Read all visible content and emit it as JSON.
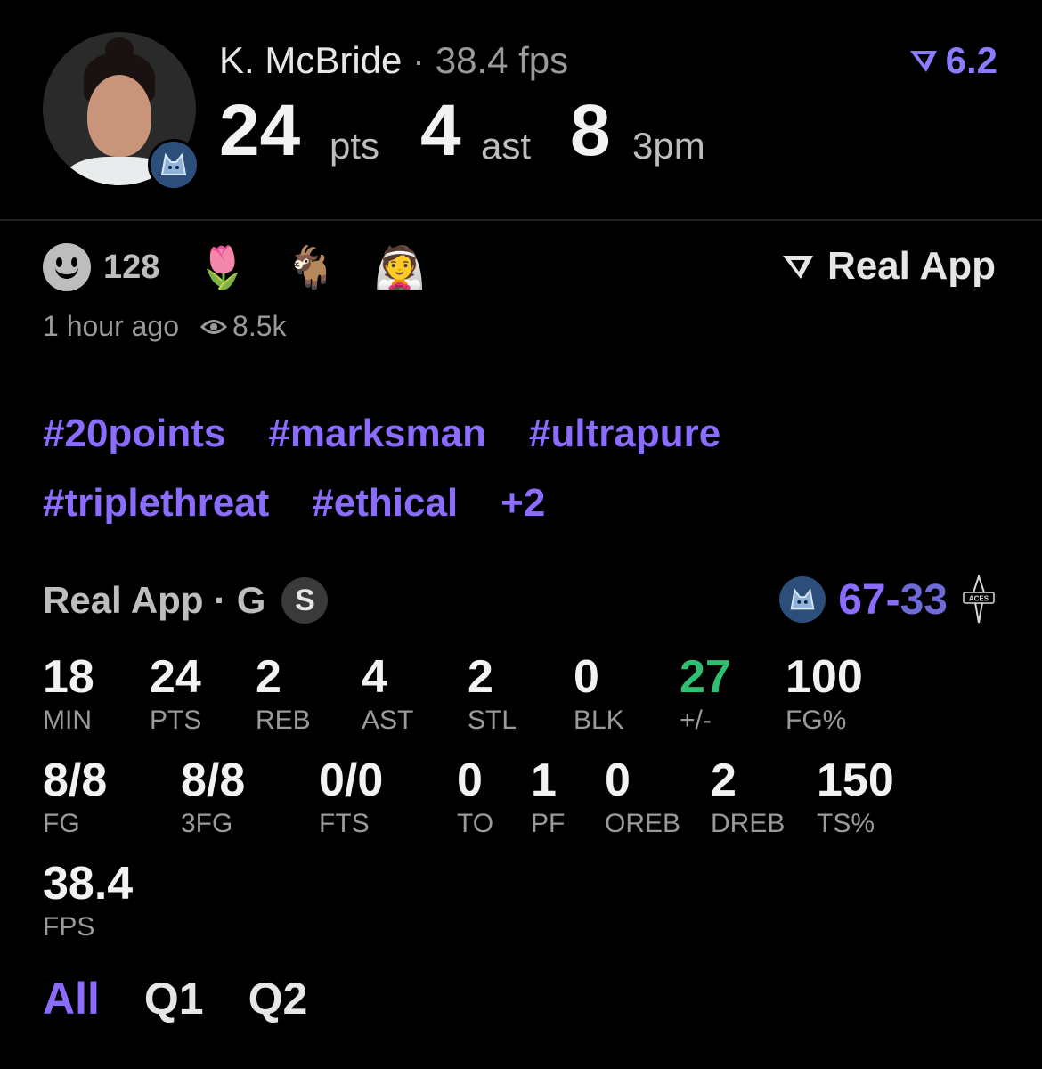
{
  "header": {
    "player_name": "K. McBride",
    "separator": " · ",
    "fps_text": "38.4 fps",
    "stats": [
      {
        "value": "24",
        "unit": "pts"
      },
      {
        "value": "4",
        "unit": "ast"
      },
      {
        "value": "8",
        "unit": "3pm"
      }
    ],
    "rating": "6.2"
  },
  "reactions": {
    "count": "128",
    "emojis": [
      {
        "name": "tulip",
        "glyph": "🌷"
      },
      {
        "name": "goat",
        "glyph": "🐐"
      },
      {
        "name": "bride",
        "glyph": "👰"
      }
    ]
  },
  "brand": "Real App",
  "meta": {
    "time_ago": "1 hour ago",
    "views": "8.5k"
  },
  "tags": {
    "row1": [
      "#20points",
      "#marksman",
      "#ultrapure"
    ],
    "row2": [
      "#triplethreat",
      "#ethical",
      "+2"
    ]
  },
  "game": {
    "label": "Real App · G",
    "badge": "S",
    "score_home": "67",
    "score_dash": "-",
    "score_away": "33"
  },
  "stats_rows": [
    [
      {
        "value": "18",
        "label": "MIN"
      },
      {
        "value": "24",
        "label": "PTS"
      },
      {
        "value": "2",
        "label": "REB"
      },
      {
        "value": "4",
        "label": "AST"
      },
      {
        "value": "2",
        "label": "STL"
      },
      {
        "value": "0",
        "label": "BLK"
      },
      {
        "value": "27",
        "label": "+/-",
        "color": "#2fbf71"
      },
      {
        "value": "100",
        "label": "FG%"
      }
    ],
    [
      {
        "value": "8/8",
        "label": "FG"
      },
      {
        "value": "8/8",
        "label": "3FG"
      },
      {
        "value": "0/0",
        "label": "FTS"
      },
      {
        "value": "0",
        "label": "TO"
      },
      {
        "value": "1",
        "label": "PF"
      },
      {
        "value": "0",
        "label": "OREB"
      },
      {
        "value": "2",
        "label": "DREB"
      },
      {
        "value": "150",
        "label": "TS%"
      }
    ],
    [
      {
        "value": "38.4",
        "label": "FPS"
      }
    ]
  ],
  "tabs": [
    {
      "label": "All",
      "active": true
    },
    {
      "label": "Q1",
      "active": false
    },
    {
      "label": "Q2",
      "active": false
    }
  ],
  "colors": {
    "accent": "#8b6cff",
    "positive": "#2fbf71",
    "background": "#000000"
  }
}
